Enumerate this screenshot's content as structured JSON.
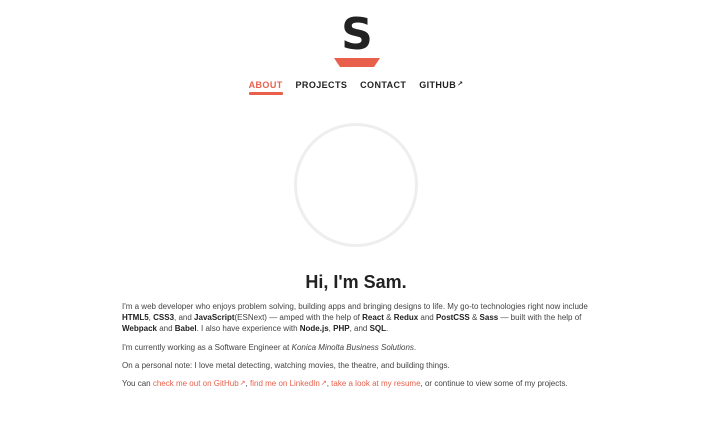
{
  "logo": {
    "letter": "S",
    "accent_color": "#e8604c"
  },
  "nav": {
    "items": [
      {
        "label": "ABOUT",
        "active": true
      },
      {
        "label": "PROJECTS",
        "active": false
      },
      {
        "label": "CONTACT",
        "active": false
      },
      {
        "label": "GITHUB",
        "active": false,
        "external_icon": "↗"
      }
    ]
  },
  "avatar": {
    "icon": "profile-photo-placeholder"
  },
  "greeting": "Hi, I'm Sam.",
  "intro": {
    "t1": "I'm a web developer who enjoys problem solving, building apps and bringing designs to life. My go-to technologies right now include ",
    "html5": "HTML5",
    "t2": ", ",
    "css3": "CSS3",
    "t3": ", and ",
    "js": "JavaScript",
    "t4": "(ESNext) — amped with the help of ",
    "react": "React",
    "t5": " & ",
    "redux": "Redux",
    "t6": " and ",
    "postcss": "PostCSS",
    "t7": " & ",
    "sass": "Sass",
    "t8": " — built with the help of ",
    "webpack": "Webpack",
    "t9": " and ",
    "babel": "Babel",
    "t10": ". I also have experience with ",
    "node": "Node.js",
    "t11": ", ",
    "php": "PHP",
    "t12": ", and ",
    "sql": "SQL",
    "t13": "."
  },
  "work": {
    "t1": "I'm currently working as a Software Engineer at ",
    "company": "Konica Minolta Business Solutions",
    "t2": "."
  },
  "personal": "On a personal note: I love metal detecting, watching movies, the theatre, and building things.",
  "links": {
    "t1": "You can ",
    "github": "check me out on GitHub",
    "ext": "↗",
    "t2": ", ",
    "linkedin": "find me on LinkedIn",
    "t3": ", ",
    "resume": "take a look at my resume",
    "t4": ", or continue to view some of my projects."
  }
}
